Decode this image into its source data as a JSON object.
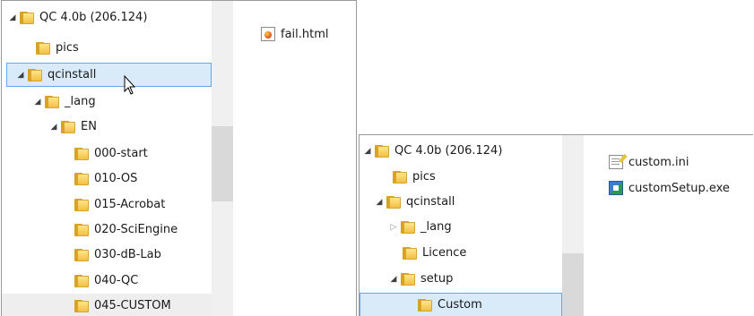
{
  "left_pane": {
    "tree": [
      {
        "label": "QC 4.0b (206.124)",
        "level": 0,
        "expand": "open"
      },
      {
        "label": "pics",
        "level": 1,
        "expand": "none"
      },
      {
        "label": "qcinstall",
        "level": 0.6,
        "expand": "open",
        "selected": true
      },
      {
        "label": "_lang",
        "level": 1,
        "expand": "open"
      },
      {
        "label": "EN",
        "level": 2,
        "expand": "open"
      },
      {
        "label": "000-start",
        "level": 3,
        "expand": "none"
      },
      {
        "label": "010-OS",
        "level": 3,
        "expand": "none"
      },
      {
        "label": "015-Acrobat",
        "level": 3,
        "expand": "none"
      },
      {
        "label": "020-SciEngine",
        "level": 3,
        "expand": "none"
      },
      {
        "label": "030-dB-Lab",
        "level": 3,
        "expand": "none"
      },
      {
        "label": "040-QC",
        "level": 3,
        "expand": "none"
      },
      {
        "label": "045-CUSTOM",
        "level": 3,
        "expand": "none",
        "highlight": true
      }
    ],
    "files": [
      {
        "name": "fail.html",
        "icon": "html-file-icon"
      }
    ]
  },
  "right_pane": {
    "tree": [
      {
        "label": "QC 4.0b (206.124)",
        "level": 0,
        "expand": "open"
      },
      {
        "label": "pics",
        "level": 1,
        "expand": "none"
      },
      {
        "label": "qcinstall",
        "level": 0.6,
        "expand": "open"
      },
      {
        "label": "_lang",
        "level": 1,
        "expand": "closed"
      },
      {
        "label": "Licence",
        "level": 1.6,
        "expand": "none"
      },
      {
        "label": "setup",
        "level": 1,
        "expand": "open"
      },
      {
        "label": "Custom",
        "level": 2.3,
        "expand": "none",
        "selected": true
      }
    ],
    "files": [
      {
        "name": "custom.ini",
        "icon": "ini-file-icon"
      },
      {
        "name": "customSetup.exe",
        "icon": "exe-file-icon"
      }
    ]
  }
}
